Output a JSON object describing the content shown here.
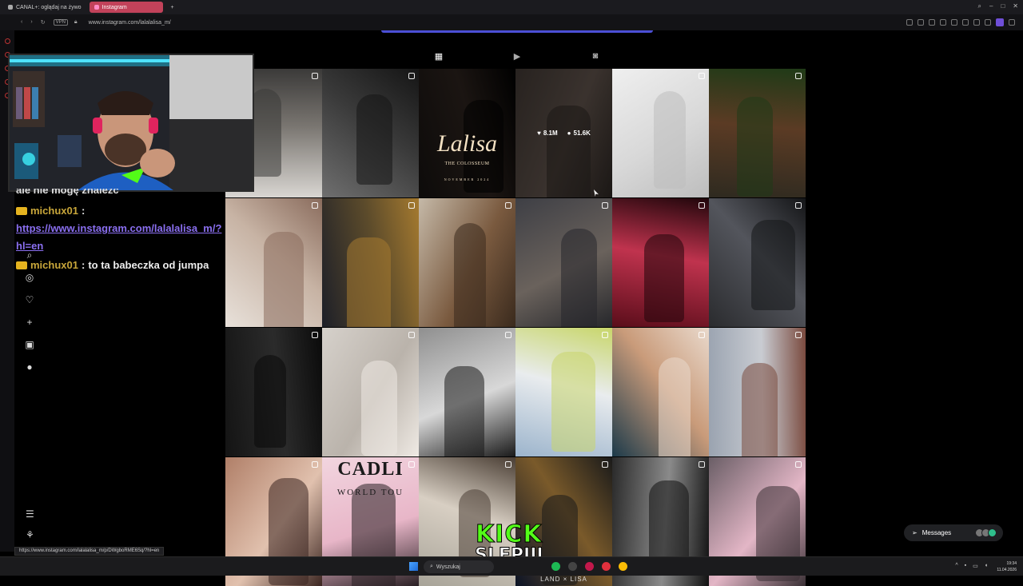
{
  "browser": {
    "tabs": [
      {
        "label": "CANAL+: oglądaj na żywo"
      },
      {
        "label": "Instagram"
      }
    ],
    "new_tab": "+",
    "vpn_label": "VPN",
    "url": "www.instagram.com/lalalalisa_m/"
  },
  "instagram": {
    "tabs": [
      "posts-tab",
      "reels-tab",
      "tagged-tab"
    ],
    "hover_stats": {
      "likes": "8.1M",
      "comments": "51.6K"
    },
    "posts": [
      {
        "id": 1,
        "colors": [
          "#d9d6d2",
          "#7a7671",
          "#3b3a39"
        ],
        "mark": true
      },
      {
        "id": 2,
        "colors": [
          "#6f6f6f",
          "#3a3a3a",
          "#151515"
        ],
        "mark": true
      },
      {
        "id": 3,
        "type": "colosseum",
        "colors": [
          "#0d0b0a",
          "#1b1512",
          "#000"
        ],
        "mark": false
      },
      {
        "id": 4,
        "colors": [
          "#3d3531",
          "#5a4e47",
          "#2a2421"
        ],
        "mark": false,
        "hover": true
      },
      {
        "id": 5,
        "colors": [
          "#efefef",
          "#d8d8d8",
          "#bdbdbd"
        ],
        "mark": true
      },
      {
        "id": 6,
        "colors": [
          "#2e2a20",
          "#5b3b24",
          "#1f3a17"
        ],
        "mark": true
      },
      {
        "id": 7,
        "colors": [
          "#e8e1da",
          "#c7b3a4",
          "#8a6c5d"
        ],
        "mark": true
      },
      {
        "id": 8,
        "colors": [
          "#1d1f28",
          "#5c4b2b",
          "#a57a2f"
        ],
        "mark": true
      },
      {
        "id": 9,
        "colors": [
          "#c5b9a8",
          "#7a5a3f",
          "#3a2a1d"
        ],
        "mark": true
      },
      {
        "id": 10,
        "colors": [
          "#3e3f45",
          "#6a625c",
          "#26272b"
        ],
        "mark": true
      },
      {
        "id": 11,
        "colors": [
          "#5a0d1a",
          "#c0334e",
          "#20060b"
        ],
        "mark": true
      },
      {
        "id": 12,
        "colors": [
          "#2a2b2e",
          "#53555c",
          "#141517"
        ],
        "mark": true
      },
      {
        "id": 13,
        "colors": [
          "#141414",
          "#2b2b2b",
          "#0a0a0a"
        ],
        "mark": true
      },
      {
        "id": 14,
        "colors": [
          "#d6d1cb",
          "#bab3ab",
          "#efeae4"
        ],
        "mark": true
      },
      {
        "id": 15,
        "colors": [
          "#8f8f8f",
          "#d8d8d8",
          "#1a1a1a"
        ],
        "mark": true
      },
      {
        "id": 16,
        "colors": [
          "#9cb4cc",
          "#e9ecee",
          "#c8d66a"
        ],
        "mark": true
      },
      {
        "id": 17,
        "colors": [
          "#1c3a4a",
          "#c99b7a",
          "#e9d9cc"
        ],
        "mark": true
      },
      {
        "id": 18,
        "colors": [
          "#9aa3b0",
          "#c9ccd2",
          "#7a4a3e"
        ],
        "mark": true
      },
      {
        "id": 19,
        "colors": [
          "#b07f68",
          "#e1c1ae",
          "#3b2520"
        ],
        "mark": true
      },
      {
        "id": 20,
        "type": "tour",
        "colors": [
          "#f2d5df",
          "#e8b6c8",
          "#2a2024"
        ],
        "mark": true
      },
      {
        "id": 21,
        "colors": [
          "#a7a398",
          "#d8cfc3",
          "#4a3e34"
        ],
        "mark": true
      },
      {
        "id": 22,
        "type": "lisa",
        "colors": [
          "#0b1326",
          "#7a5a2a",
          "#1a1a1a"
        ],
        "mark": true
      },
      {
        "id": 23,
        "colors": [
          "#2a2a2a",
          "#8a8a8a",
          "#111"
        ],
        "mark": true
      },
      {
        "id": 24,
        "colors": [
          "#6a5e66",
          "#e3b6c6",
          "#3a3035"
        ],
        "mark": true
      }
    ],
    "colosseum": {
      "title": "Lalisa",
      "subtitle": "THE COLOSSEUM",
      "date": "NOVEMBER 2024"
    },
    "tour": {
      "line1": "CADLI",
      "line2": "WORLD TOU"
    },
    "lisa_caption": "LAND × LISA",
    "messages_label": "Messages"
  },
  "chat": {
    "cut_text": "ale nie mogę znaleźć",
    "messages": [
      {
        "user": "michux01",
        "sep": ":",
        "text": "",
        "link": "https://www.instagram.com/lalalalisa_m/?hl=en"
      },
      {
        "user": "michux01",
        "sep": ":",
        "text": "to ta babeczka od jumpa"
      }
    ]
  },
  "overlay": {
    "kick_line1": "KICK",
    "kick_line2": "SLEPIII"
  },
  "status_url": "https://www.instagram.com/lalalalisa_m/p/DWgboRME6Sq/?hl=en",
  "taskbar": {
    "search_placeholder": "Wyszukaj",
    "time": "19:34",
    "date": "11.04.2026"
  },
  "colors": {
    "accent": "#4b4fd6",
    "link": "#8a6ff0",
    "kick": "#53fc18",
    "tab_active": "#c2425a"
  }
}
